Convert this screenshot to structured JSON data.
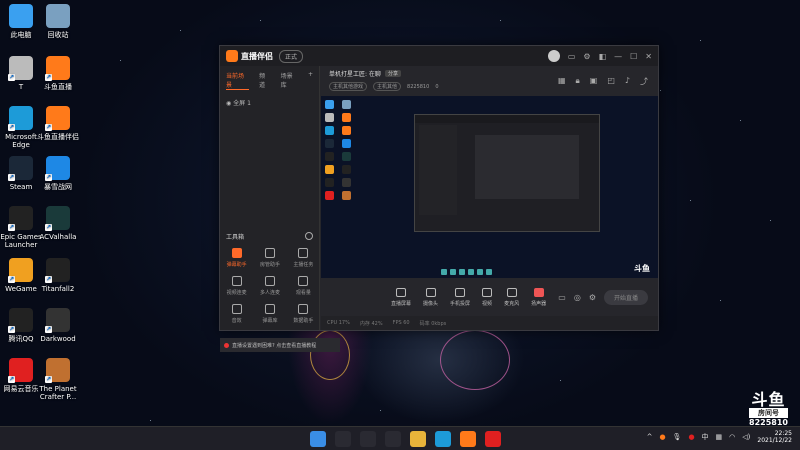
{
  "desktop": {
    "icons": [
      {
        "label": "此电脑",
        "icon": "computer-icon",
        "color": "#3aa0f0"
      },
      {
        "label": "回收站",
        "icon": "recycle-bin-icon",
        "color": "#7aa0c0"
      },
      {
        "label": "T",
        "icon": "drive-icon",
        "color": "#bbbbbb"
      },
      {
        "label": "斗鱼直播",
        "icon": "douyu-icon",
        "color": "#ff7a1a"
      },
      {
        "label": "Microsoft Edge",
        "icon": "edge-icon",
        "color": "#1d9bd8"
      },
      {
        "label": "斗鱼直播伴侣",
        "icon": "douyu-companion-icon",
        "color": "#ff7a1a"
      },
      {
        "label": "Steam",
        "icon": "steam-icon",
        "color": "#1b2838"
      },
      {
        "label": "暴雪战网",
        "icon": "battlenet-icon",
        "color": "#1e88e5"
      },
      {
        "label": "Epic Games Launcher",
        "icon": "epic-icon",
        "color": "#222222"
      },
      {
        "label": "ACValhalla",
        "icon": "acvalhalla-icon",
        "color": "#1a3a3a"
      },
      {
        "label": "WeGame",
        "icon": "wegame-icon",
        "color": "#f0a020"
      },
      {
        "label": "Titanfall2",
        "icon": "titanfall-icon",
        "color": "#222222"
      },
      {
        "label": "腾讯QQ",
        "icon": "qq-icon",
        "color": "#222222"
      },
      {
        "label": "Darkwood",
        "icon": "darkwood-icon",
        "color": "#333333"
      },
      {
        "label": "网易云音乐",
        "icon": "netease-music-icon",
        "color": "#e02020"
      },
      {
        "label": "The Planet Crafter P...",
        "icon": "planet-crafter-icon",
        "color": "#c07030"
      }
    ]
  },
  "app": {
    "name": "直播伴侣",
    "version": "正式",
    "left_tabs": [
      "当前场景",
      "频道",
      "场景库"
    ],
    "scene_row": "全屏 1",
    "tools_title": "工具箱",
    "tools": [
      {
        "label": "弹幕助手",
        "hot": true
      },
      {
        "label": "房管助手",
        "hot": false
      },
      {
        "label": "主播任务",
        "hot": false
      },
      {
        "label": "视频连麦",
        "hot": false
      },
      {
        "label": "多人连麦",
        "hot": false
      },
      {
        "label": "观看量",
        "hot": false
      },
      {
        "label": "音效",
        "hot": false
      },
      {
        "label": "弹幕库",
        "hot": false
      },
      {
        "label": "数据助手",
        "hot": false
      }
    ],
    "room": {
      "title": "单机打星工匠: 在聊",
      "chip": "分享",
      "tags": [
        "主机其他游戏",
        "主机其他"
      ],
      "room_id": "8225810",
      "viewers": "0"
    },
    "controls": [
      {
        "label": "直播屏幕",
        "icon": "screen-icon"
      },
      {
        "label": "摄像头",
        "icon": "camera-icon"
      },
      {
        "label": "手机投屏",
        "icon": "phone-cast-icon"
      },
      {
        "label": "视频",
        "icon": "video-icon"
      },
      {
        "label": "麦克风",
        "icon": "mic-icon"
      },
      {
        "label": "扬声器",
        "icon": "speaker-icon",
        "red": true
      }
    ],
    "go_live": "开始直播",
    "notice": "直播设置遇到困难? 点击查看直播教程",
    "status": [
      "CPU 17%",
      "内存 42%",
      "FPS 60",
      "码率 0kbps"
    ]
  },
  "watermark": {
    "logo": "斗鱼",
    "room_label": "房间号",
    "room_number": "8225810"
  },
  "taskbar": {
    "apps": [
      {
        "icon": "windows-start-icon",
        "color": "#3a8ee6"
      },
      {
        "icon": "search-icon",
        "color": "#2a2a32"
      },
      {
        "icon": "task-view-icon",
        "color": "#2a2a32"
      },
      {
        "icon": "widgets-icon",
        "color": "#2a2a32"
      },
      {
        "icon": "file-explorer-icon",
        "color": "#e8b43a"
      },
      {
        "icon": "edge-icon",
        "color": "#1d9bd8"
      },
      {
        "icon": "douyu-companion-icon",
        "color": "#ff7a1a"
      },
      {
        "icon": "netease-music-icon",
        "color": "#e02020"
      }
    ],
    "ime": "中",
    "time": "22:25",
    "date": "2021/12/22"
  }
}
